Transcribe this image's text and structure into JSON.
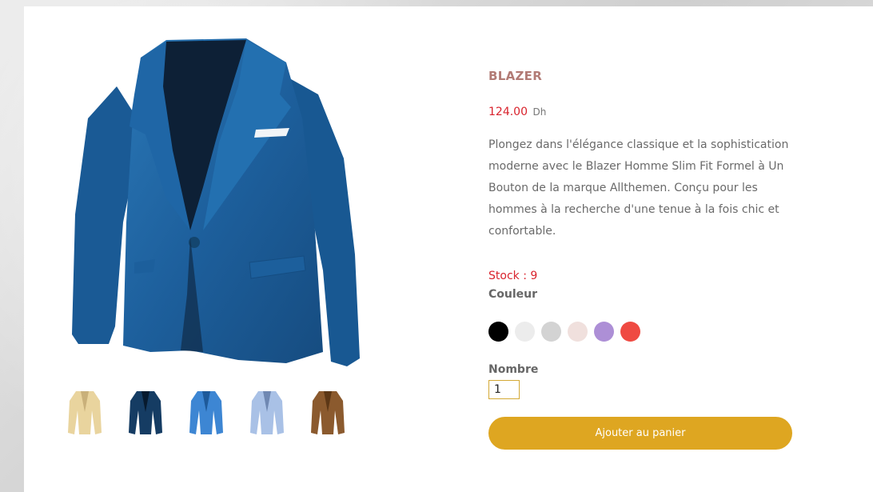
{
  "product": {
    "title": "BLAZER",
    "price": "124.00",
    "currency": "Dh",
    "description": "Plongez dans l'élégance classique et la sophistication moderne avec le Blazer Homme Slim Fit Formel à Un Bouton de la marque Allthemen. Conçu pour les hommes à la recherche d'une tenue à la fois chic et confortable.",
    "stock_text": "Stock : 9",
    "color_label": "Couleur",
    "quantity_label": "Nombre",
    "quantity_value": "1",
    "add_to_cart_label": "Ajouter au panier"
  },
  "main_image": {
    "icon": "blazer-image",
    "color": "#1f64a3"
  },
  "thumbnails": [
    {
      "icon": "blazer-thumbnail-beige",
      "color": "#e9d49e"
    },
    {
      "icon": "blazer-thumbnail-navy",
      "color": "#153c63"
    },
    {
      "icon": "blazer-thumbnail-blue",
      "color": "#3d86d3"
    },
    {
      "icon": "blazer-thumbnail-light-blue",
      "color": "#a9c1e6"
    },
    {
      "icon": "blazer-thumbnail-brown",
      "color": "#8b5a2e"
    }
  ],
  "colors": [
    "#000000",
    "#ececec",
    "#d3d3d3",
    "#f0e0dd",
    "#ad8fd6",
    "#ef4a42"
  ],
  "theme": {
    "accent": "#dea621",
    "title_color": "#b27b75",
    "price_color": "#d9232d"
  }
}
